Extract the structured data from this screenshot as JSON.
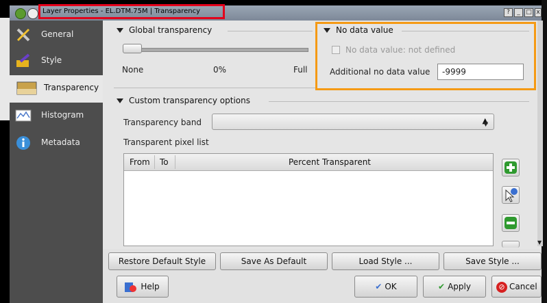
{
  "window": {
    "title": "Layer Properties - EL.DTM.75M | Transparency",
    "buttons": [
      "?",
      "_",
      "□",
      "x"
    ]
  },
  "sidebar": {
    "items": [
      {
        "label": "General",
        "icon": "wrench-icon"
      },
      {
        "label": "Style",
        "icon": "paintbrush-icon"
      },
      {
        "label": "Transparency",
        "icon": "transparency-icon",
        "active": true
      },
      {
        "label": "Histogram",
        "icon": "histogram-icon"
      },
      {
        "label": "Metadata",
        "icon": "info-icon"
      }
    ]
  },
  "global_transparency": {
    "title": "Global transparency",
    "min_label": "None",
    "value_label": "0%",
    "max_label": "Full",
    "value_fraction": 0.0
  },
  "no_data": {
    "title": "No data value",
    "checkbox_label": "No data value:  not defined",
    "checked": false,
    "additional_label": "Additional no data value",
    "additional_value": "-9999"
  },
  "custom_transparency": {
    "title": "Custom transparency options",
    "band_label": "Transparency band",
    "band_value": "",
    "pixel_list_label": "Transparent pixel list",
    "columns": [
      "From",
      "To",
      "Percent Transparent"
    ],
    "rows": []
  },
  "style_buttons": {
    "restore": "Restore Default Style",
    "save_default": "Save As Default",
    "load": "Load Style ...",
    "save": "Save Style ..."
  },
  "dialog_buttons": {
    "help": "Help",
    "ok": "OK",
    "apply": "Apply",
    "cancel": "Cancel"
  },
  "colors": {
    "title_highlight": "#e3001b",
    "no_data_highlight": "#f59a14"
  }
}
